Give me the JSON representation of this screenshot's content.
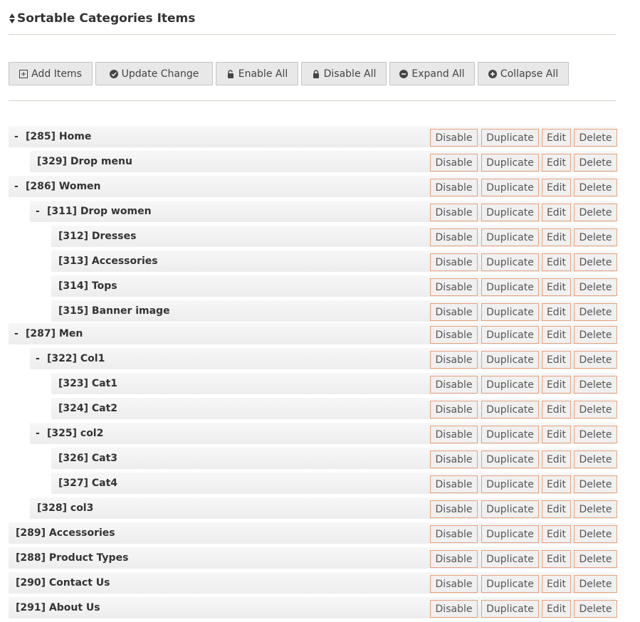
{
  "header": {
    "title": "Sortable Categories Items",
    "icon": "sort-icon"
  },
  "toolbar": {
    "buttons": [
      {
        "label": "Add Items",
        "icon": "plus-square-icon"
      },
      {
        "label": "Update Change",
        "icon": "check-circle-icon"
      },
      {
        "label": "Enable All",
        "icon": "unlock-icon"
      },
      {
        "label": "Disable All",
        "icon": "lock-icon"
      },
      {
        "label": "Expand All",
        "icon": "minus-circle-icon"
      },
      {
        "label": "Collapse All",
        "icon": "plus-circle-icon"
      }
    ]
  },
  "actions": {
    "disable": "Disable",
    "duplicate": "Duplicate",
    "edit": "Edit",
    "delete": "Delete"
  },
  "toggle_symbol": "-",
  "colors": {
    "button_border": "#e8a27b",
    "row_bg": "#f2f2f2",
    "toolbar_bg": "#e8e8e8"
  },
  "items": [
    {
      "label": "[285] Home",
      "depth": 0,
      "toggle": true
    },
    {
      "label": "[329] Drop menu",
      "depth": 1,
      "toggle": false
    },
    {
      "label": "[286] Women",
      "depth": 0,
      "toggle": true
    },
    {
      "label": "[311] Drop women",
      "depth": 1,
      "toggle": true
    },
    {
      "label": "[312] Dresses",
      "depth": 2,
      "toggle": false
    },
    {
      "label": "[313] Accessories",
      "depth": 2,
      "toggle": false
    },
    {
      "label": "[314] Tops",
      "depth": 2,
      "toggle": false
    },
    {
      "label": "[315] Banner image",
      "depth": 2,
      "toggle": false
    },
    {
      "label": "[287] Men",
      "depth": 0,
      "toggle": true
    },
    {
      "label": "[322] Col1",
      "depth": 1,
      "toggle": true
    },
    {
      "label": "[323] Cat1",
      "depth": 2,
      "toggle": false
    },
    {
      "label": "[324] Cat2",
      "depth": 2,
      "toggle": false
    },
    {
      "label": "[325] col2",
      "depth": 1,
      "toggle": true
    },
    {
      "label": "[326] Cat3",
      "depth": 2,
      "toggle": false
    },
    {
      "label": "[327] Cat4",
      "depth": 2,
      "toggle": false
    },
    {
      "label": "[328] col3",
      "depth": 1,
      "toggle": false
    },
    {
      "label": "[289] Accessories",
      "depth": 0,
      "toggle": false
    },
    {
      "label": "[288] Product Types",
      "depth": 0,
      "toggle": false
    },
    {
      "label": "[290] Contact Us",
      "depth": 0,
      "toggle": false
    },
    {
      "label": "[291] About Us",
      "depth": 0,
      "toggle": false
    }
  ]
}
